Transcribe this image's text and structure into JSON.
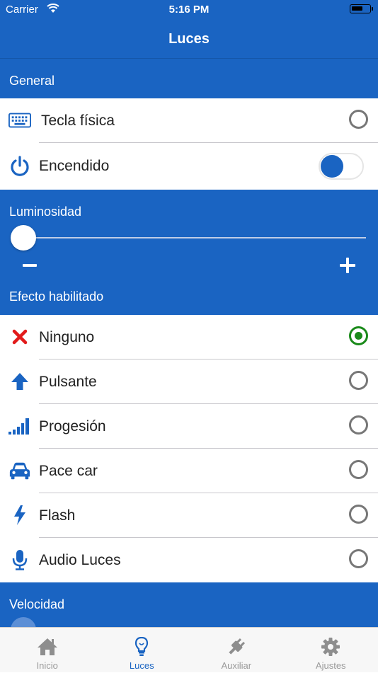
{
  "status": {
    "carrier": "Carrier",
    "time": "5:16 PM"
  },
  "nav": {
    "title": "Luces"
  },
  "sections": {
    "general": "General",
    "brightness": "Luminosidad",
    "effect": "Efecto habilitado",
    "speed": "Velocidad"
  },
  "general_rows": [
    {
      "label": "Tecla física",
      "icon": "keyboard-icon",
      "control": "radio",
      "selected": false
    },
    {
      "label": "Encendido",
      "icon": "power-icon",
      "control": "toggle",
      "on": false
    }
  ],
  "brightness": {
    "value": 0,
    "minus_label": "−",
    "plus_label": "+"
  },
  "effects": [
    {
      "label": "Ninguno",
      "icon": "x-mark-icon",
      "selected": true
    },
    {
      "label": "Pulsante",
      "icon": "arrow-up-icon",
      "selected": false
    },
    {
      "label": "Progesión",
      "icon": "signal-bars-icon",
      "selected": false
    },
    {
      "label": "Pace car",
      "icon": "car-icon",
      "selected": false
    },
    {
      "label": "Flash",
      "icon": "lightning-icon",
      "selected": false
    },
    {
      "label": "Audio Luces",
      "icon": "microphone-icon",
      "selected": false
    }
  ],
  "tabs": [
    {
      "label": "Inicio",
      "icon": "home-icon",
      "active": false
    },
    {
      "label": "Luces",
      "icon": "lightbulb-icon",
      "active": true
    },
    {
      "label": "Auxiliar",
      "icon": "plug-icon",
      "active": false
    },
    {
      "label": "Ajustes",
      "icon": "gear-icon",
      "active": false
    }
  ],
  "colors": {
    "primary": "#1a64c2",
    "selected": "#1a8a1a",
    "error": "#e21b1b"
  }
}
